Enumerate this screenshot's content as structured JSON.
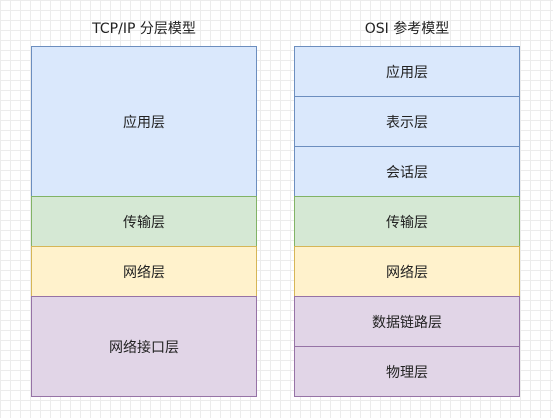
{
  "tcpip": {
    "title": "TCP/IP 分层模型",
    "layers": [
      {
        "label": "应用层",
        "color": "#dae8fc",
        "border": "#6c8ebf"
      },
      {
        "label": "传输层",
        "color": "#d5e8d4",
        "border": "#82b366"
      },
      {
        "label": "网络层",
        "color": "#fff2cc",
        "border": "#d6b656"
      },
      {
        "label": "网络接口层",
        "color": "#e1d5e7",
        "border": "#9673a6"
      }
    ]
  },
  "osi": {
    "title": "OSI 参考模型",
    "layers": [
      {
        "label": "应用层",
        "color": "#dae8fc",
        "border": "#6c8ebf"
      },
      {
        "label": "表示层",
        "color": "#dae8fc",
        "border": "#6c8ebf"
      },
      {
        "label": "会话层",
        "color": "#dae8fc",
        "border": "#6c8ebf"
      },
      {
        "label": "传输层",
        "color": "#d5e8d4",
        "border": "#82b366"
      },
      {
        "label": "网络层",
        "color": "#fff2cc",
        "border": "#d6b656"
      },
      {
        "label": "数据链路层",
        "color": "#e1d5e7",
        "border": "#9673a6"
      },
      {
        "label": "物理层",
        "color": "#e1d5e7",
        "border": "#9673a6"
      }
    ]
  }
}
